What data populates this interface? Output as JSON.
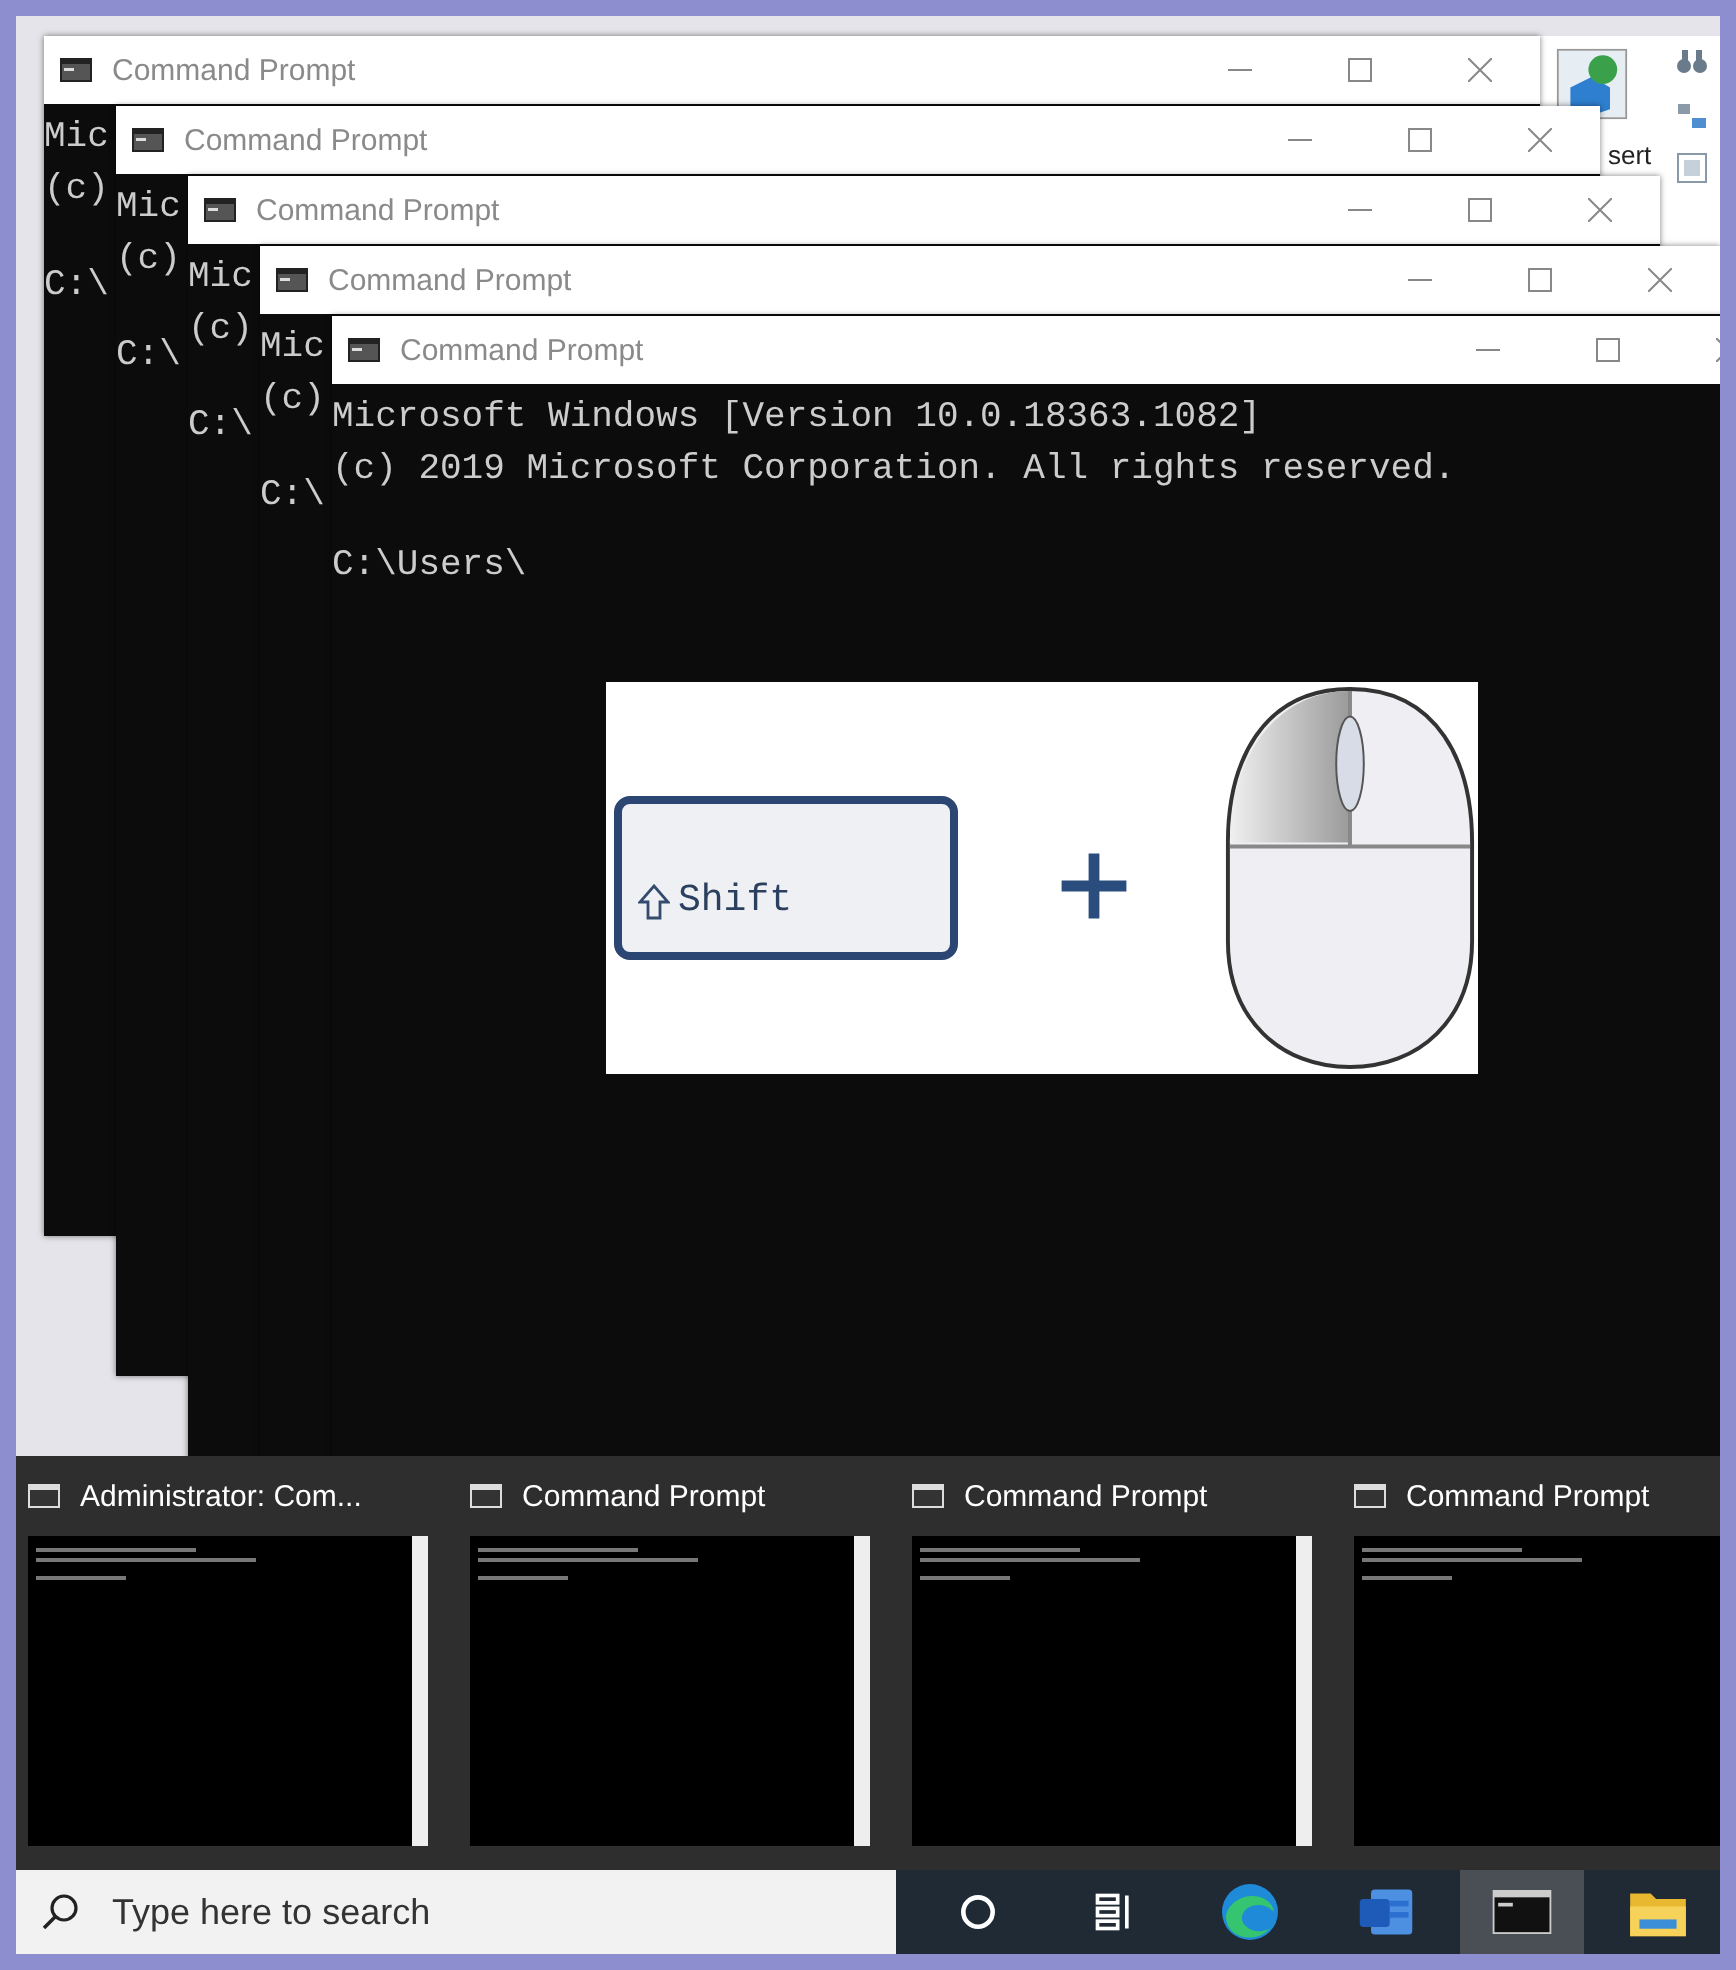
{
  "background_app": {
    "ribbon_label": "sert"
  },
  "windows": [
    {
      "title": "Command Prompt",
      "lines": [
        "Mic",
        "(c)",
        "C:\\"
      ]
    },
    {
      "title": "Command Prompt",
      "lines": [
        "Mic",
        "(c)",
        "C:\\"
      ]
    },
    {
      "title": "Command Prompt",
      "lines": [
        "Mic",
        "(c)",
        "C:\\"
      ]
    },
    {
      "title": "Command Prompt",
      "lines": [
        "Mic",
        "(c)",
        "C:\\"
      ]
    },
    {
      "title": "Command Prompt",
      "lines": [
        "Microsoft Windows [Version 10.0.18363.1082]",
        "(c) 2019 Microsoft Corporation. All rights reserved.",
        "C:\\Users\\"
      ]
    }
  ],
  "illustration": {
    "key_label": "Shift"
  },
  "previews": [
    {
      "title": "Administrator: Com..."
    },
    {
      "title": "Command Prompt"
    },
    {
      "title": "Command Prompt"
    },
    {
      "title": "Command Prompt"
    }
  ],
  "taskbar": {
    "search": {
      "placeholder": "Type here to search"
    },
    "apps": [
      {
        "kind": "cortana",
        "active": false
      },
      {
        "kind": "task-view",
        "active": false
      },
      {
        "kind": "browser",
        "active": false
      },
      {
        "kind": "word",
        "active": false
      },
      {
        "kind": "terminal",
        "active": true
      },
      {
        "kind": "folder",
        "active": false
      }
    ]
  }
}
